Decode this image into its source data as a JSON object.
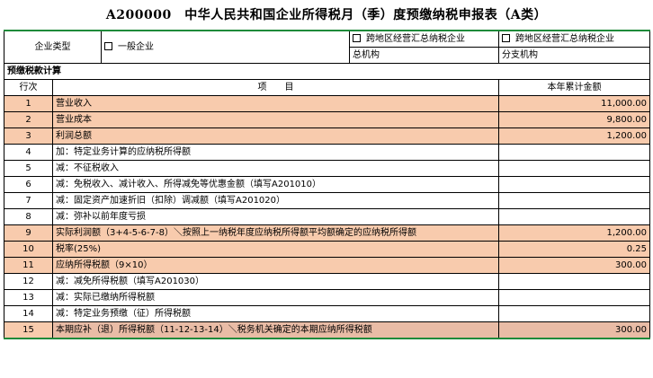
{
  "title": "A200000　中华人民共和国企业所得税月（季）度预缴纳税申报表（A类）",
  "enterprise": {
    "type_label": "企业类型",
    "option_general": "一般企业",
    "option_hq_line1": "跨地区经营汇总纳税企业",
    "option_hq_line2": "总机构",
    "option_branch_line1": "跨地区经营汇总纳税企业",
    "option_branch_line2": "分支机构"
  },
  "section_label": "预缴税款计算",
  "headers": {
    "row_no": "行次",
    "item": "项　　目",
    "amount": "本年累计金额"
  },
  "rows": [
    {
      "no": "1",
      "item": "营业收入",
      "amount": "11,000.00",
      "hl": true
    },
    {
      "no": "2",
      "item": "营业成本",
      "amount": "9,800.00",
      "hl": true
    },
    {
      "no": "3",
      "item": "利润总额",
      "amount": "1,200.00",
      "hl": true
    },
    {
      "no": "4",
      "item": "加：特定业务计算的应纳税所得额",
      "amount": "",
      "hl": false
    },
    {
      "no": "5",
      "item": "减：不征税收入",
      "amount": "",
      "hl": false
    },
    {
      "no": "6",
      "item": "减：免税收入、减计收入、所得减免等优惠金额（填写A201010）",
      "amount": "",
      "hl": false
    },
    {
      "no": "7",
      "item": "减：固定资产加速折旧（扣除）调减额（填写A201020）",
      "amount": "",
      "hl": false
    },
    {
      "no": "8",
      "item": "减：弥补以前年度亏损",
      "amount": "",
      "hl": false
    },
    {
      "no": "9",
      "item": "实际利润额（3+4-5-6-7-8）＼按照上一纳税年度应纳税所得额平均额确定的应纳税所得额",
      "amount": "1,200.00",
      "hl": true
    },
    {
      "no": "10",
      "item": "税率(25%)",
      "amount": "0.25",
      "hl": true
    },
    {
      "no": "11",
      "item": "应纳所得税额（9×10）",
      "amount": "300.00",
      "hl": true
    },
    {
      "no": "12",
      "item": "减：减免所得税额（填写A201030）",
      "amount": "",
      "hl": false
    },
    {
      "no": "13",
      "item": "减：实际已缴纳所得税额",
      "amount": "",
      "hl": false
    },
    {
      "no": "14",
      "item": "减：特定业务预缴（征）所得税额",
      "amount": "",
      "hl": false
    },
    {
      "no": "15",
      "item": "本期应补（退）所得税额（11-12-13-14）＼税务机关确定的本期应纳所得税额",
      "amount": "300.00",
      "hl": true
    }
  ]
}
